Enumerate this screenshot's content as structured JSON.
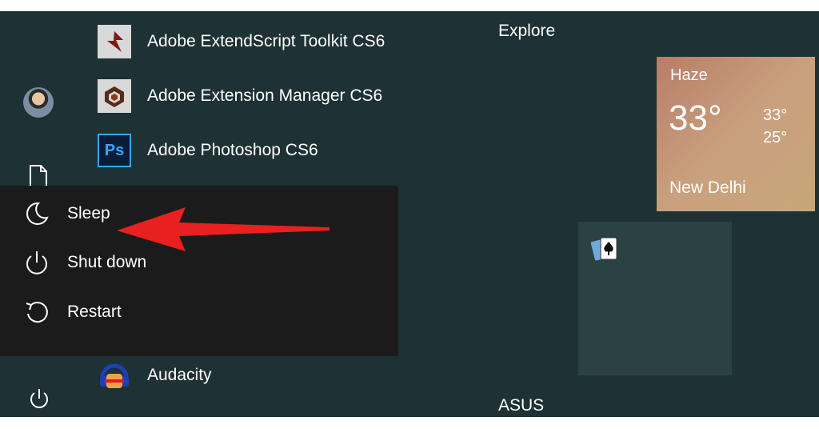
{
  "apps": [
    {
      "label": "Adobe ExtendScript Toolkit CS6",
      "icon": "extendscript-icon"
    },
    {
      "label": "Adobe Extension Manager CS6",
      "icon": "extension-manager-icon"
    },
    {
      "label": "Adobe Photoshop CS6",
      "icon": "photoshop-icon",
      "icon_text": "Ps"
    },
    {
      "label": "Audacity",
      "icon": "audacity-icon"
    }
  ],
  "power_menu": {
    "items": [
      {
        "label": "Sleep",
        "icon": "moon-icon"
      },
      {
        "label": "Shut down",
        "icon": "power-icon"
      },
      {
        "label": "Restart",
        "icon": "restart-icon"
      }
    ]
  },
  "tiles": {
    "explore_title": "Explore",
    "asus_title": "ASUS",
    "weather": {
      "condition": "Haze",
      "temperature": "33°",
      "high": "33°",
      "low": "25°",
      "city": "New Delhi"
    },
    "solitaire": {
      "icon": "solitaire-cards-icon"
    }
  },
  "colors": {
    "start_background": "#1e3134",
    "power_menu_background": "#1b1b1b",
    "annotation_arrow": "#e8201f",
    "photoshop_blue": "#31a8ff"
  }
}
